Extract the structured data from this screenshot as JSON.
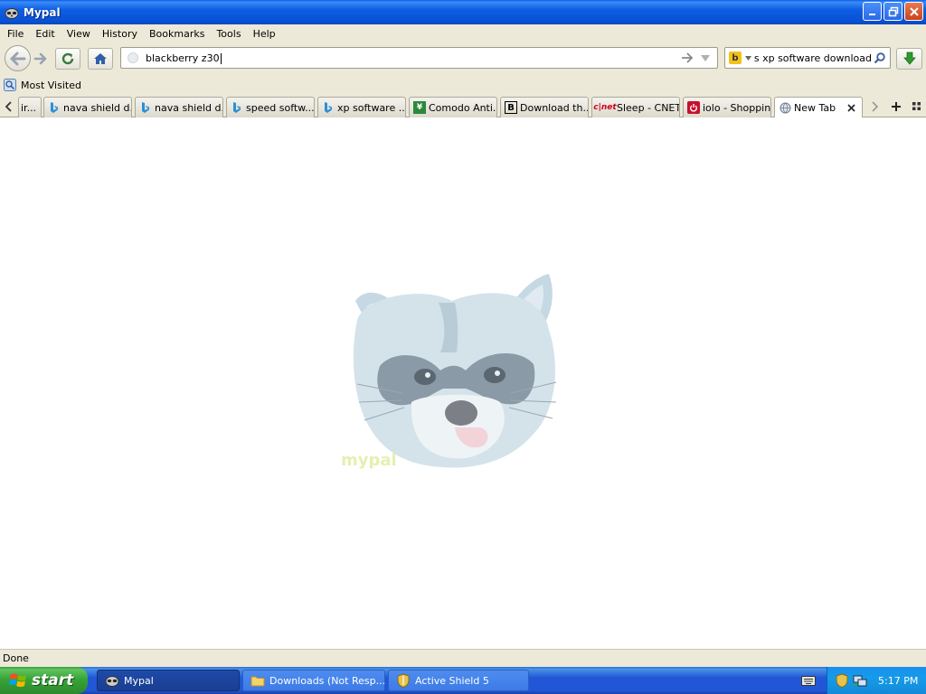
{
  "window": {
    "title": "Mypal",
    "buttons": [
      "minimize",
      "maximize",
      "close"
    ]
  },
  "menu": {
    "items": [
      "File",
      "Edit",
      "View",
      "History",
      "Bookmarks",
      "Tools",
      "Help"
    ]
  },
  "navigation": {
    "url": "blackberry z30",
    "search_text": "ws xp software  download",
    "search_engine_icon": "bing-icon"
  },
  "bookmarks": {
    "label": "Most Visited"
  },
  "tabs": [
    {
      "label": "ir...",
      "icon": "page-icon"
    },
    {
      "label": "nava shield d...",
      "icon": "bing-icon"
    },
    {
      "label": "nava shield d...",
      "icon": "bing-icon"
    },
    {
      "label": "speed softw...",
      "icon": "bing-icon"
    },
    {
      "label": "xp software ...",
      "icon": "bing-icon"
    },
    {
      "label": "Comodo Anti...",
      "icon": "comodo-icon"
    },
    {
      "label": "Download th...",
      "icon": "b-icon"
    },
    {
      "label": "Sleep - CNET",
      "icon": "cnet-icon"
    },
    {
      "label": "iolo - Shoppin...",
      "icon": "power-icon"
    },
    {
      "label": "New Tab",
      "icon": "globe-icon",
      "active": true
    }
  ],
  "content": {
    "logo_text": "mypal"
  },
  "status": {
    "text": "Done"
  },
  "taskbar": {
    "start_label": "start",
    "tasks": [
      {
        "label": "Mypal",
        "icon": "raccoon-icon",
        "active": true
      },
      {
        "label": "Downloads (Not Resp...",
        "icon": "folder-icon",
        "active": false
      },
      {
        "label": "Active Shield 5",
        "icon": "shield-icon",
        "active": false
      }
    ],
    "clock": "5:17 PM"
  }
}
